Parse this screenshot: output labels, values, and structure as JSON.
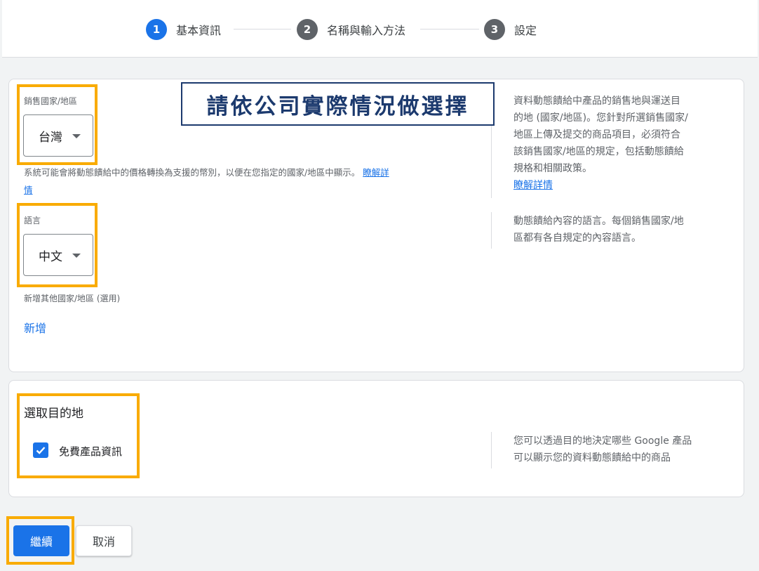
{
  "stepper": {
    "steps": [
      {
        "number": "1",
        "label": "基本資訊"
      },
      {
        "number": "2",
        "label": "名稱與輸入方法"
      },
      {
        "number": "3",
        "label": "設定"
      }
    ]
  },
  "callout": {
    "text": "請依公司實際情況做選擇"
  },
  "country_section": {
    "label": "銷售國家/地區",
    "selected": "台灣",
    "help": "系統可能會將動態饋給中的價格轉換為支援的幣別，以便在您指定的國家/地區中顯示。",
    "help_link_1": "瞭解詳",
    "help_link_2": "情",
    "side_text_lines": [
      "資料動態饋給中產品的銷售地與運送目",
      "的地 (國家/地區)。您針對所選銷售國家/",
      "地區上傳及提交的商品項目，必須符合",
      "該銷售國家/地區的規定，包括動態饋給",
      "規格和相關政策。"
    ],
    "side_link": "瞭解詳情"
  },
  "language_section": {
    "label": "語言",
    "selected": "中文",
    "side_text_lines": [
      "動態饋給內容的語言。每個銷售國家/地",
      "區都有各自規定的內容語言。"
    ]
  },
  "additional_country": {
    "label": "新增其他國家/地區 (選用)",
    "add_link": "新增"
  },
  "destinations": {
    "title": "選取目的地",
    "checkbox_label": "免費產品資訊",
    "checked": true,
    "side_text_lines": [
      "您可以透過目的地決定哪些 Google 產品",
      "可以顯示您的資料動態饋給中的商品"
    ]
  },
  "footer": {
    "continue_label": "繼續",
    "cancel_label": "取消"
  },
  "colors": {
    "accent": "#1a73e8",
    "highlight": "#f9ab00",
    "callout": "#1c3a6e"
  }
}
